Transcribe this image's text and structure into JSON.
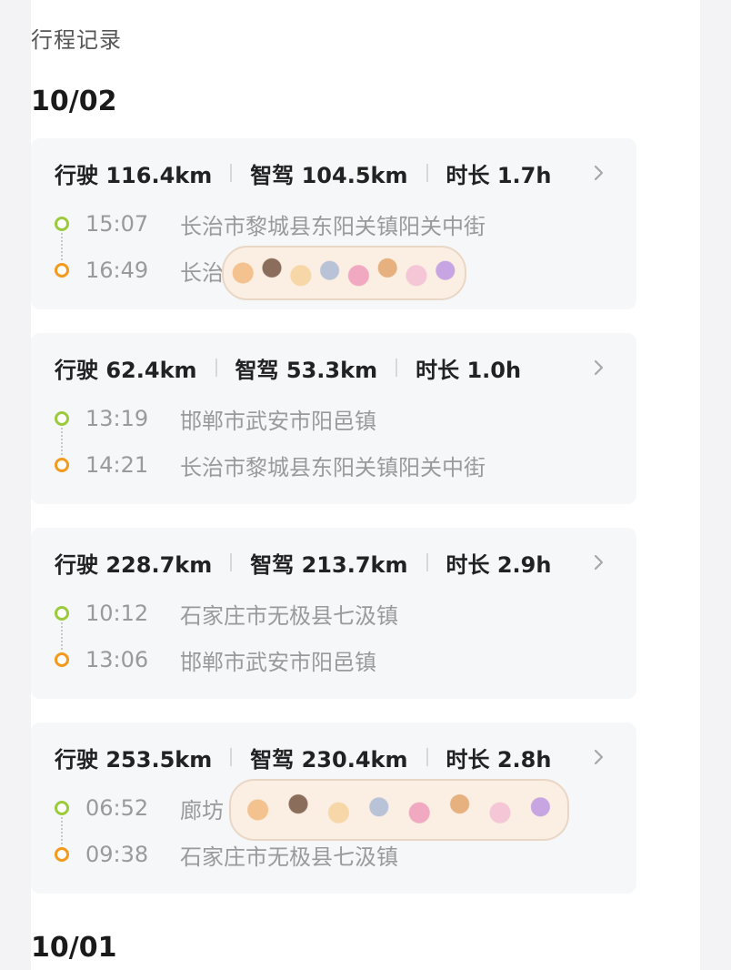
{
  "page_title": "行程记录",
  "groups": [
    {
      "date": "10/02",
      "trips": [
        {
          "drive": "行驶 116.4km",
          "smart": "智驾 104.5km",
          "duration": "时长 1.7h",
          "start_time": "15:07",
          "start_addr": "长治市黎城县东阳关镇阳关中街",
          "end_time": "16:49",
          "end_addr": "长治市"
        },
        {
          "drive": "行驶 62.4km",
          "smart": "智驾 53.3km",
          "duration": "时长 1.0h",
          "start_time": "13:19",
          "start_addr": "邯郸市武安市阳邑镇",
          "end_time": "14:21",
          "end_addr": "长治市黎城县东阳关镇阳关中街"
        },
        {
          "drive": "行驶 228.7km",
          "smart": "智驾 213.7km",
          "duration": "时长 2.9h",
          "start_time": "10:12",
          "start_addr": "石家庄市无极县七汲镇",
          "end_time": "13:06",
          "end_addr": "邯郸市武安市阳邑镇"
        },
        {
          "drive": "行驶 253.5km",
          "smart": "智驾 230.4km",
          "duration": "时长 2.8h",
          "start_time": "06:52",
          "start_addr": "廊坊",
          "end_time": "09:38",
          "end_addr": "石家庄市无极县七汲镇"
        }
      ]
    },
    {
      "date": "10/01",
      "trips": []
    }
  ],
  "colors": {
    "start_dot": "#9bcb3c",
    "end_dot": "#f39a1e"
  },
  "icons": {
    "chevron": "chevron-right-icon",
    "start": "start-dot-icon",
    "end": "end-dot-icon"
  }
}
